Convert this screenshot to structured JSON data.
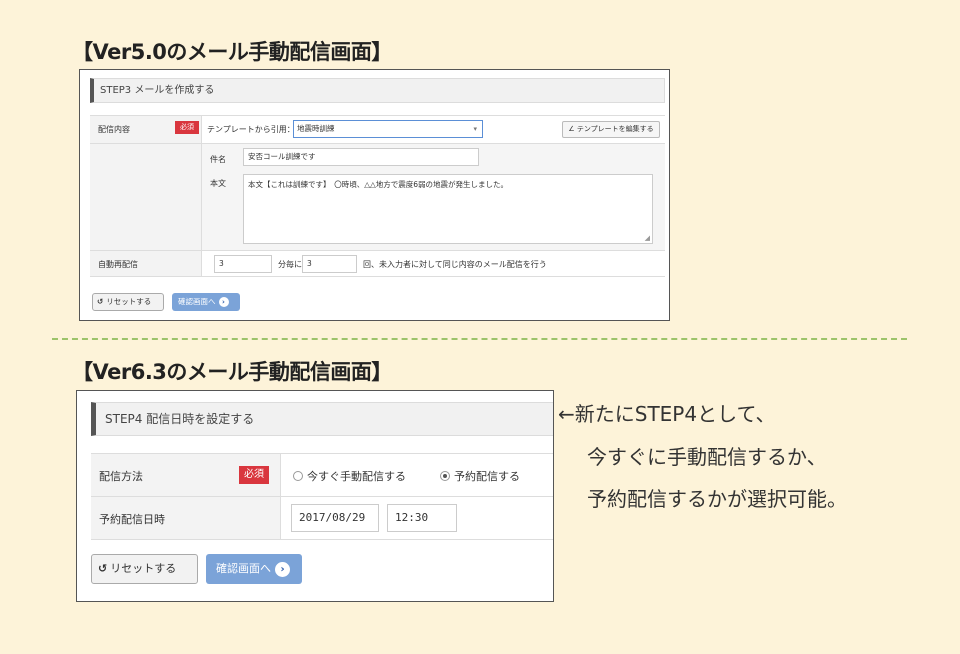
{
  "headings": {
    "v5": "【Ver5.0のメール手動配信画面】",
    "v6": "【Ver6.3のメール手動配信画面】"
  },
  "v5": {
    "step_title": "STEP3 メールを作成する",
    "content_label": "配信内容",
    "required_badge": "必須",
    "template_label": "テンプレートから引用：",
    "template_value": "地震時訓練",
    "edit_template_button": "テンプレートを編集する",
    "subject_label": "件名",
    "subject_value": "安否コール訓練です",
    "body_label": "本文",
    "body_value": "本文【これは訓練です】　〇時頃、△△地方で震度6弱の地震が発生しました。",
    "resend_label": "自動再配信",
    "resend_interval_value": "3",
    "resend_interval_unit": "分毎に",
    "resend_count_value": "3",
    "resend_suffix": "回、未入力者に対して同じ内容のメール配信を行う",
    "reset_button": "リセットする",
    "confirm_button": "確認画面へ"
  },
  "v6": {
    "step_title": "STEP4 配信日時を設定する",
    "method_label": "配信方法",
    "required_badge": "必須",
    "option_now": "今すぐ手動配信する",
    "option_scheduled": "予約配信する",
    "selected_option": "予約配信する",
    "schedule_label": "予約配信日時",
    "date_value": "2017/08/29",
    "time_value": "12:30",
    "reset_button": "リセットする",
    "confirm_button": "確認画面へ"
  },
  "annotation": {
    "line1": "←新たにSTEP4として、",
    "line2": "今すぐに手動配信するか、",
    "line3": "予約配信するかが選択可能。"
  },
  "colors": {
    "page_background": "#fdf3d9",
    "required_badge": "#d9363e",
    "confirm_button": "#7ba3d8",
    "divider": "#9cc36a"
  },
  "icons": {
    "reset": "reset-icon",
    "arrow": "arrow-right-circle-icon",
    "dropdown": "chevron-down-icon",
    "edit": "pencil-icon"
  }
}
